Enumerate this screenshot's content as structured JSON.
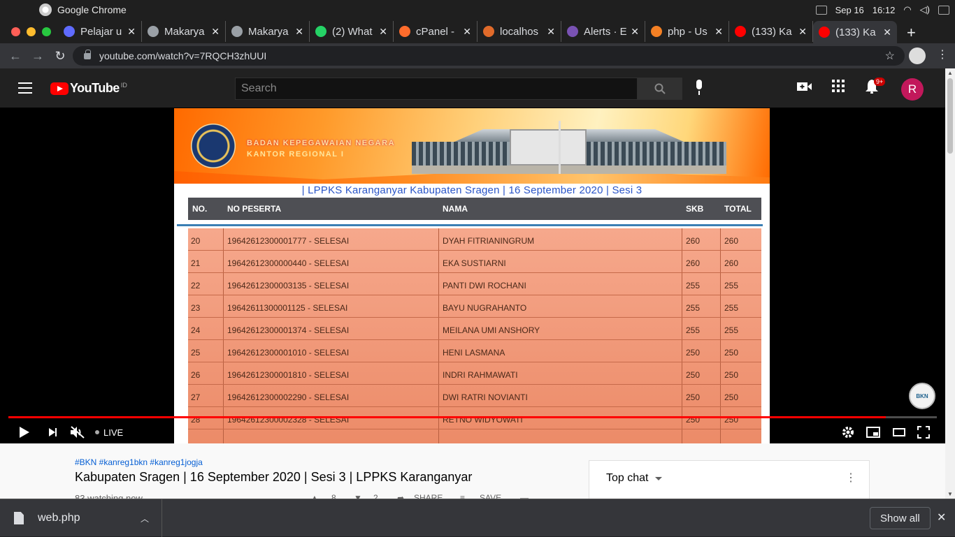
{
  "os": {
    "app_name": "Google Chrome",
    "date": "Sep 16",
    "time": "16:12"
  },
  "tabs": [
    {
      "title": "Pelajar u",
      "icon": "pelajar-icon",
      "color": "#5f6bff"
    },
    {
      "title": "Makarya",
      "icon": "globe-icon",
      "color": "#9aa0a6"
    },
    {
      "title": "Makarya",
      "icon": "globe-icon",
      "color": "#9aa0a6"
    },
    {
      "title": "(2) What",
      "icon": "whatsapp-icon",
      "color": "#25d366"
    },
    {
      "title": "cPanel -",
      "icon": "cpanel-icon",
      "color": "#ff6c2c"
    },
    {
      "title": "localhos",
      "icon": "localhost-icon",
      "color": "#e06a2a"
    },
    {
      "title": "Alerts · E",
      "icon": "bootstrap-icon",
      "color": "#7952b3"
    },
    {
      "title": "php - Us",
      "icon": "stackoverflow-icon",
      "color": "#f48024"
    },
    {
      "title": "(133) Ka",
      "icon": "youtube-icon",
      "color": "#ff0000"
    },
    {
      "title": "(133) Ka",
      "icon": "youtube-icon",
      "color": "#ff0000"
    }
  ],
  "address": {
    "url": "youtube.com/watch?v=7RQCH3zhUUI"
  },
  "youtube": {
    "logo_text": "YouTube",
    "logo_region": "ID",
    "search_placeholder": "Search",
    "notification_count": "9+",
    "avatar_letter": "R"
  },
  "video": {
    "org_name": "BADAN KEPEGAWAIAN NEGARA",
    "org_sub": "KANTOR REGIONAL I",
    "subtitle": "| LPPKS Karanganyar     Kabupaten Sragen | 16 September 2020 | Sesi 3",
    "headers": [
      "NO.",
      "NO PESERTA",
      "NAMA",
      "SKB",
      "TOTAL"
    ],
    "rows": [
      {
        "no": "20",
        "peserta": "19642612300001777 - SELESAI",
        "nama": "DYAH FITRIANINGRUM",
        "skb": "260",
        "total": "260"
      },
      {
        "no": "21",
        "peserta": "19642612300000440 - SELESAI",
        "nama": "EKA SUSTIARNI",
        "skb": "260",
        "total": "260"
      },
      {
        "no": "22",
        "peserta": "19642612300003135 - SELESAI",
        "nama": "PANTI DWI ROCHANI",
        "skb": "255",
        "total": "255"
      },
      {
        "no": "23",
        "peserta": "19642611300001125 - SELESAI",
        "nama": "BAYU NUGRAHANTO",
        "skb": "255",
        "total": "255"
      },
      {
        "no": "24",
        "peserta": "19642612300001374 - SELESAI",
        "nama": "MEILANA UMI ANSHORY",
        "skb": "255",
        "total": "255"
      },
      {
        "no": "25",
        "peserta": "19642612300001010 - SELESAI",
        "nama": "HENI LASMANA",
        "skb": "250",
        "total": "250"
      },
      {
        "no": "26",
        "peserta": "19642612300001810 - SELESAI",
        "nama": "INDRI RAHMAWATI",
        "skb": "250",
        "total": "250"
      },
      {
        "no": "27",
        "peserta": "19642612300002290 - SELESAI",
        "nama": "DWI RATRI NOVIANTI",
        "skb": "250",
        "total": "250"
      },
      {
        "no": "28",
        "peserta": "19642612300002328 - SELESAI",
        "nama": "RETNO WIDYOWATI",
        "skb": "250",
        "total": "250"
      }
    ],
    "watermark": "BKN",
    "progress_fraction": 0.945,
    "live_label": "LIVE"
  },
  "below": {
    "hashtags": "#BKN #kanreg1bkn #kanreg1jogja",
    "title": "Kabupaten Sragen | 16 September 2020 | Sesi 3 | LPPKS Karanganyar",
    "watching": "83 watching now",
    "likes": "8",
    "dislikes": "2",
    "share": "SHARE",
    "save": "SAVE"
  },
  "chat": {
    "title": "Top chat"
  },
  "download": {
    "file": "web.php",
    "show_all": "Show all"
  }
}
